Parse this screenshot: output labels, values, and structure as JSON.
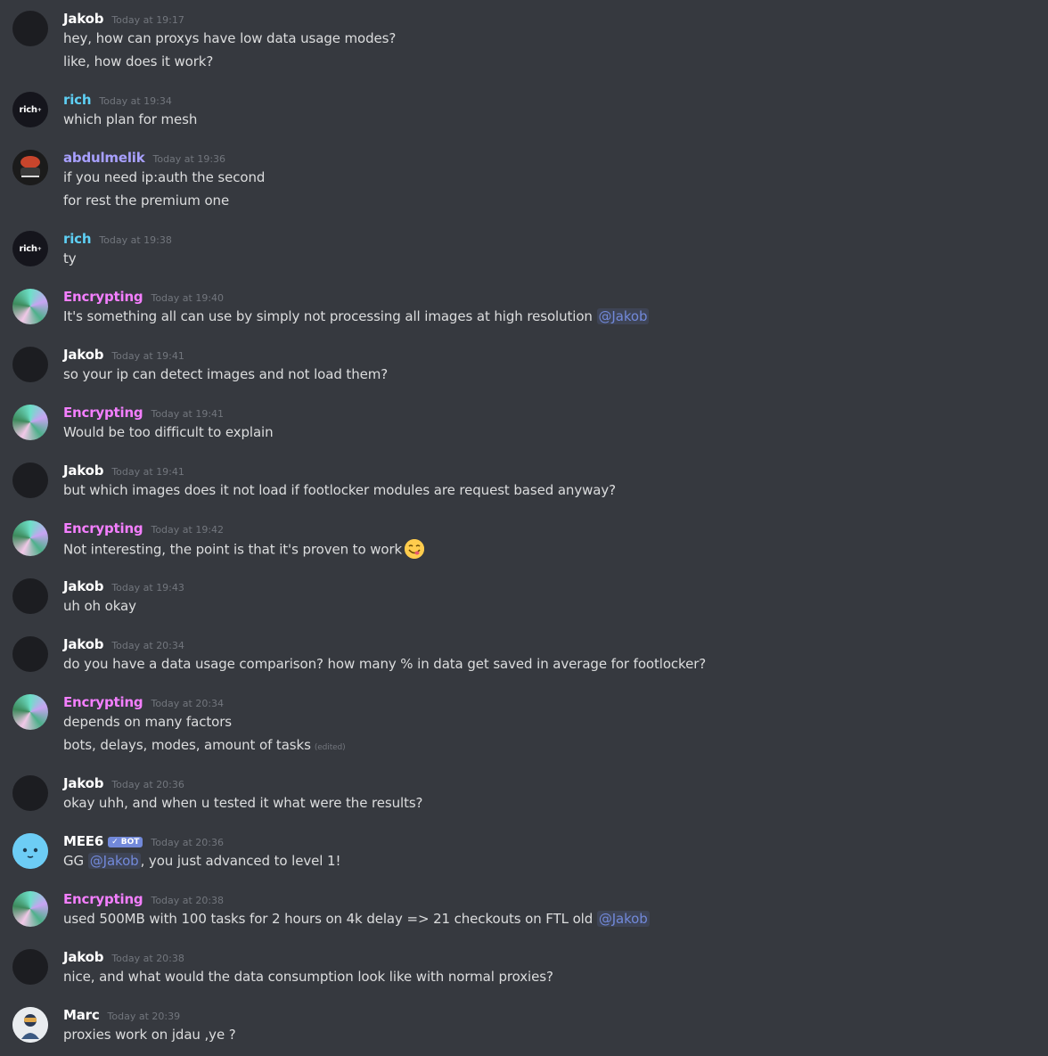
{
  "messages": [
    {
      "author": "Jakob",
      "time": "Today at 19:17",
      "lines": [
        "hey, how can proxys have low data usage modes?",
        "like, how does it work?"
      ]
    },
    {
      "author": "rich",
      "time": "Today at 19:34",
      "avatar_text": "rich",
      "lines": [
        "which plan for mesh"
      ]
    },
    {
      "author": "abdulmelik",
      "time": "Today at 19:36",
      "lines": [
        "if you need ip:auth the second",
        "for rest the premium one"
      ]
    },
    {
      "author": "rich",
      "time": "Today at 19:38",
      "avatar_text": "rich",
      "lines": [
        "ty"
      ]
    },
    {
      "author": "Encrypting",
      "time": "Today at 19:40",
      "text": "It's something all can use by simply not processing all images at high resolution ",
      "mention": "@Jakob"
    },
    {
      "author": "Jakob",
      "time": "Today at 19:41",
      "lines": [
        "so your ip can detect images and not load them?"
      ]
    },
    {
      "author": "Encrypting",
      "time": "Today at 19:41",
      "lines": [
        "Would be too difficult to explain"
      ]
    },
    {
      "author": "Jakob",
      "time": "Today at 19:41",
      "lines": [
        "but which images does it not load if footlocker modules are request based anyway?"
      ]
    },
    {
      "author": "Encrypting",
      "time": "Today at 19:42",
      "text": "Not interesting, the point is that it's proven to work",
      "emoji": "yum-emoji"
    },
    {
      "author": "Jakob",
      "time": "Today at 19:43",
      "lines": [
        "uh oh okay"
      ]
    },
    {
      "author": "Jakob",
      "time": "Today at 20:34",
      "lines": [
        "do you have a data usage comparison? how many % in data get saved in average for footlocker?"
      ]
    },
    {
      "author": "Encrypting",
      "time": "Today at 20:34",
      "lines": [
        "depends on many factors",
        "bots, delays, modes, amount of tasks"
      ],
      "edited": "(edited)"
    },
    {
      "author": "Jakob",
      "time": "Today at 20:36",
      "lines": [
        "okay uhh, and when u tested it what were the results?"
      ]
    },
    {
      "author": "MEE6",
      "time": "Today at 20:36",
      "badge": "BOT",
      "pre": "GG ",
      "mention": "@Jakob",
      "post": ", you just advanced to level 1!"
    },
    {
      "author": "Encrypting",
      "time": "Today at 20:38",
      "text": "used 500MB with 100 tasks for 2 hours on 4k delay => 21 checkouts on FTL old ",
      "mention": "@Jakob"
    },
    {
      "author": "Jakob",
      "time": "Today at 20:38",
      "lines": [
        "nice, and what would the data consumption look like with normal proxies?"
      ]
    },
    {
      "author": "Marc",
      "time": "Today at 20:39",
      "lines": [
        "proxies work on jdau ,ye ?"
      ]
    }
  ],
  "colors": {
    "background": "#36393f",
    "mention": "#7289da",
    "encrypting": "#f47fff",
    "rich": "#5ed0f5",
    "abdulmelik": "#a8a0ff"
  }
}
